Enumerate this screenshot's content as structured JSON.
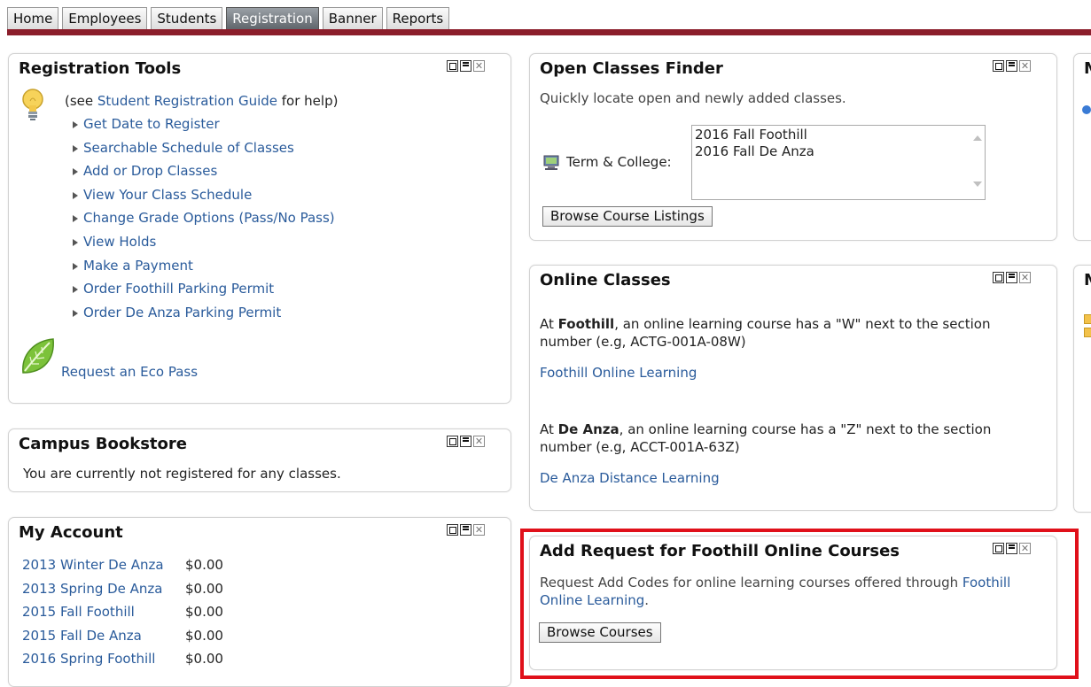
{
  "tabs": [
    "Home",
    "Employees",
    "Students",
    "Registration",
    "Banner",
    "Reports"
  ],
  "active_tab": "Registration",
  "registration_tools": {
    "title": "Registration Tools",
    "help_prefix": "(see ",
    "help_link": "Student Registration Guide",
    "help_suffix": " for help)",
    "links": [
      "Get Date to Register",
      "Searchable Schedule of Classes",
      "Add or Drop Classes",
      "View Your Class Schedule",
      "Change Grade Options (Pass/No Pass)",
      "View Holds",
      "Make a Payment",
      "Order Foothill Parking Permit",
      "Order De Anza Parking Permit"
    ],
    "eco_pass": "Request an Eco Pass"
  },
  "bookstore": {
    "title": "Campus Bookstore",
    "message": "You are currently not registered for any classes."
  },
  "account": {
    "title": "My Account",
    "rows": [
      {
        "term": "2013 Winter De Anza",
        "amount": "$0.00"
      },
      {
        "term": "2013 Spring De Anza",
        "amount": "$0.00"
      },
      {
        "term": "2015 Fall Foothill",
        "amount": "$0.00"
      },
      {
        "term": "2015 Fall De Anza",
        "amount": "$0.00"
      },
      {
        "term": "2016 Spring Foothill",
        "amount": "$0.00"
      }
    ]
  },
  "open_classes": {
    "title": "Open Classes Finder",
    "desc": "Quickly locate open and newly added classes.",
    "term_label": "Term & College:",
    "options": [
      "2016 Fall Foothill",
      "2016 Fall De Anza"
    ],
    "button": "Browse Course Listings"
  },
  "online_classes": {
    "title": "Online Classes",
    "foothill_prefix": "At ",
    "foothill_name": "Foothill",
    "foothill_text": ", an online learning course has a \"W\" next to the section number (e.g, ACTG-001A-08W)",
    "foothill_link": "Foothill Online Learning",
    "deanza_prefix": "At ",
    "deanza_name": "De Anza",
    "deanza_text": ", an online learning course has a \"Z\" next to the section number (e.g, ACCT-001A-63Z)",
    "deanza_link": "De Anza Distance Learning"
  },
  "add_request": {
    "title": "Add Request for Foothill Online Courses",
    "desc": "Request Add Codes for online learning courses offered through ",
    "desc_link": "Foothill Online Learning",
    "desc_end": ".",
    "button": "Browse Courses"
  },
  "right_cut_titles": [
    "M",
    "M"
  ],
  "colors": {
    "accent_bar": "#8b1e2b",
    "link": "#2a5b9b",
    "highlight": "#e0101a"
  }
}
